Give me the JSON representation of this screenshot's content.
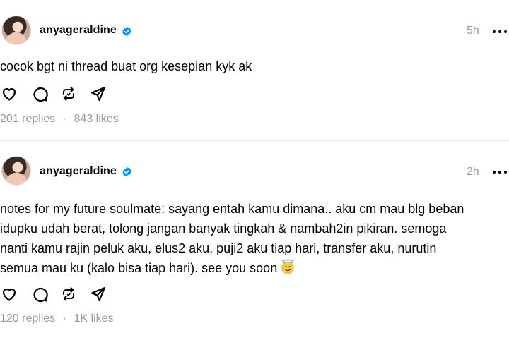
{
  "posts": [
    {
      "username": "anyageraldine",
      "time": "5h",
      "text": "cocok bgt ni thread buat org kesepian kyk ak",
      "replies": "201 replies",
      "separator": "·",
      "likes": "843 likes"
    },
    {
      "username": "anyageraldine",
      "time": "2h",
      "text": "notes for my future soulmate: sayang entah kamu dimana.. aku cm mau blg beban\nidupku udah berat, tolong jangan banyak tingkah & nambah2in pikiran. semoga\nnanti kamu rajin peluk aku, elus2 aku, puji2 aku tiap hari, transfer aku, nurutin\nsemua mau ku (kalo bisa tiap hari). see you soon",
      "emoji": "smiling-face-with-halo",
      "replies": "120 replies",
      "separator": "·",
      "likes": "1K likes"
    }
  ],
  "colors": {
    "verified": "#0095f6",
    "muted": "#999999",
    "divider": "#e6e6e6"
  },
  "icons": [
    "heart-icon",
    "comment-icon",
    "repost-icon",
    "share-icon",
    "verified-badge-icon",
    "more-icon"
  ]
}
